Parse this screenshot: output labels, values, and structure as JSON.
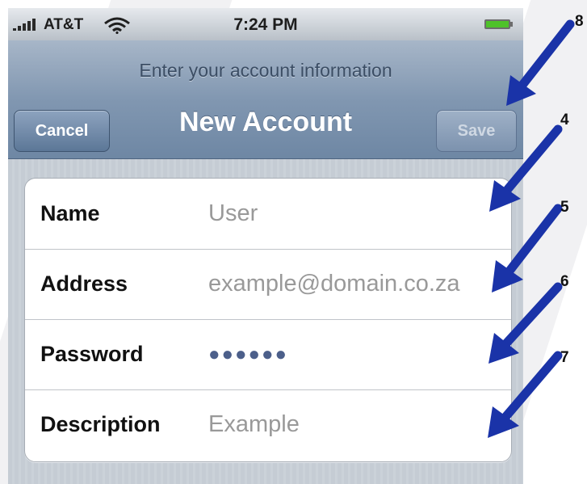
{
  "status_bar": {
    "carrier": "AT&T",
    "time": "7:24 PM",
    "signal_icon": "signal-bars-icon",
    "wifi_icon": "wifi-icon",
    "battery_icon": "battery-icon"
  },
  "nav": {
    "prompt": "Enter your account information",
    "title": "New Account",
    "cancel_label": "Cancel",
    "save_label": "Save"
  },
  "form": {
    "rows": [
      {
        "label": "Name",
        "value": "User"
      },
      {
        "label": "Address",
        "value": "example@domain.co.za"
      },
      {
        "label": "Password",
        "value": "●●●●●●"
      },
      {
        "label": "Description",
        "value": "Example"
      }
    ]
  },
  "callouts": [
    "8",
    "4",
    "5",
    "6",
    "7"
  ],
  "colors": {
    "nav_bar": "#7a92ae",
    "background": "#c5ccd4",
    "arrow": "#1a33a8",
    "battery": "#4ec22a"
  }
}
